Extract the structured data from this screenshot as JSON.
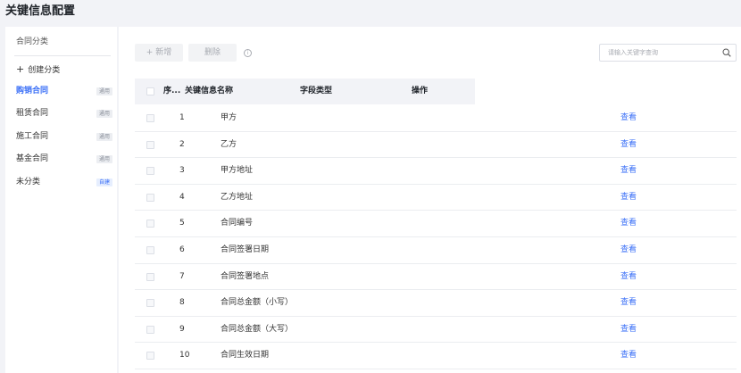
{
  "page_title": "关键信息配置",
  "sidebar": {
    "heading": "合同分类",
    "create_label": "创建分类",
    "create_icon": "plus-icon",
    "items": [
      {
        "label": "购销合同",
        "badge": "通用",
        "active": true
      },
      {
        "label": "租赁合同",
        "badge": "通用",
        "active": false
      },
      {
        "label": "施工合同",
        "badge": "通用",
        "active": false
      },
      {
        "label": "基金合同",
        "badge": "通用",
        "active": false
      },
      {
        "label": "未分类",
        "badge": "自建",
        "active": false
      }
    ]
  },
  "toolbar": {
    "add_label": "+ 新增",
    "delete_label": "删除",
    "info_icon": "info-icon",
    "search_placeholder": "请输入关键字查询",
    "search_icon": "search-icon"
  },
  "table": {
    "headers": {
      "index": "序...",
      "name": "关键信息名称",
      "type": "字段类型",
      "action": "操作"
    },
    "rows": [
      {
        "index": "1",
        "name": "甲方",
        "action": "查看"
      },
      {
        "index": "2",
        "name": "乙方",
        "action": "查看"
      },
      {
        "index": "3",
        "name": "甲方地址",
        "action": "查看"
      },
      {
        "index": "4",
        "name": "乙方地址",
        "action": "查看"
      },
      {
        "index": "5",
        "name": "合同编号",
        "action": "查看"
      },
      {
        "index": "6",
        "name": "合同签署日期",
        "action": "查看"
      },
      {
        "index": "7",
        "name": "合同签署地点",
        "action": "查看"
      },
      {
        "index": "8",
        "name": "合同总金额（小写）",
        "action": "查看"
      },
      {
        "index": "9",
        "name": "合同总金额（大写）",
        "action": "查看"
      },
      {
        "index": "10",
        "name": "合同生效日期",
        "action": "查看"
      }
    ]
  },
  "colors": {
    "accent": "#3a6ff7",
    "background": "#f2f3f7"
  }
}
